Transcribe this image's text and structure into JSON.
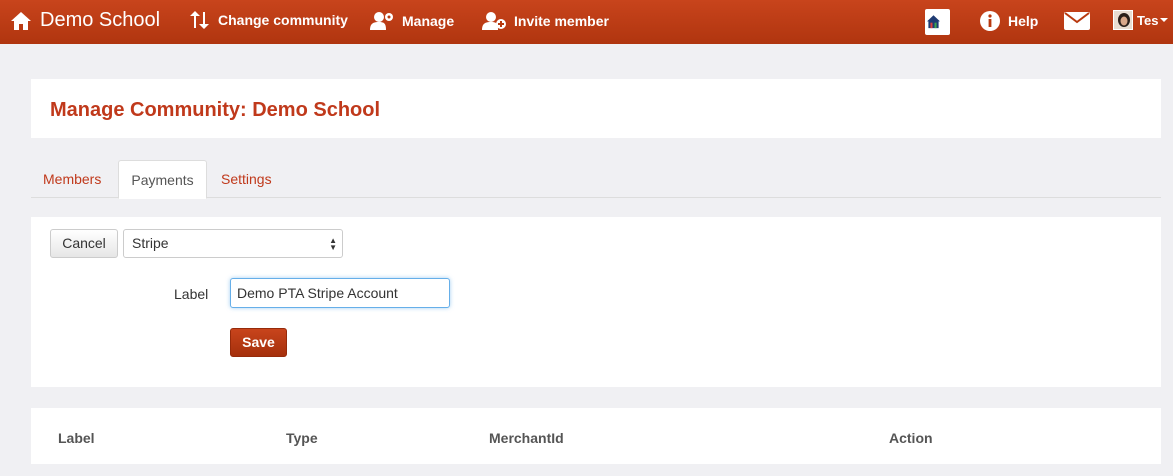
{
  "navbar": {
    "brand": "Demo School",
    "change_community": "Change community",
    "manage": "Manage",
    "invite_member": "Invite member",
    "help": "Help",
    "user": "Tes"
  },
  "page": {
    "title": "Manage Community: Demo School"
  },
  "tabs": [
    {
      "label": "Members",
      "active": false
    },
    {
      "label": "Payments",
      "active": true
    },
    {
      "label": "Settings",
      "active": false
    }
  ],
  "form": {
    "cancel_label": "Cancel",
    "provider_selected": "Stripe",
    "label_field_label": "Label",
    "label_field_value": "Demo PTA Stripe Account",
    "save_label": "Save"
  },
  "table": {
    "columns": [
      "Label",
      "Type",
      "MerchantId",
      "Action"
    ]
  },
  "colors": {
    "brand": "#c0391b",
    "navbar_top": "#c8441c",
    "navbar_bottom": "#b0350f",
    "background": "#f0f0f3"
  }
}
